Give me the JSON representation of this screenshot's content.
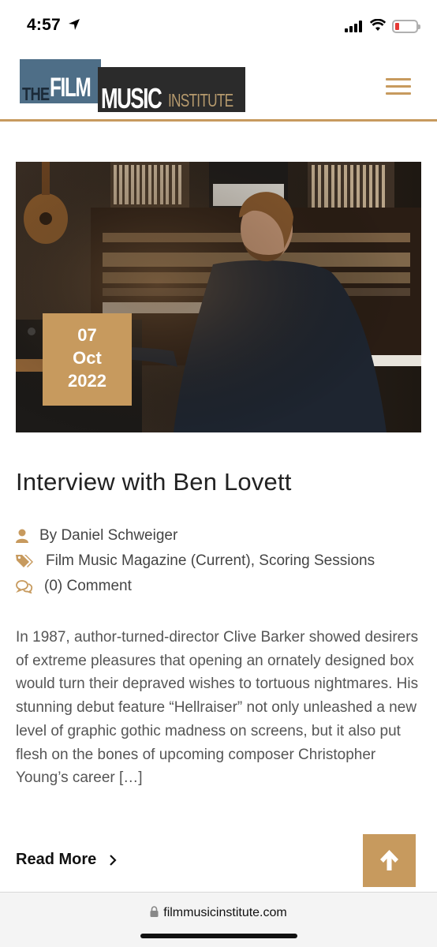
{
  "status_bar": {
    "time": "4:57"
  },
  "header": {
    "logo": {
      "the": "THE",
      "film": "FILM",
      "music": "MUSIC",
      "institute": "INSTITUTE"
    }
  },
  "post": {
    "date": {
      "day": "07",
      "month": "Oct",
      "year": "2022"
    },
    "title": "Interview with Ben Lovett",
    "author": "By Daniel Schweiger",
    "categories": "Film Music Magazine (Current), Scoring Sessions",
    "comments": "(0) Comment",
    "excerpt": "In 1987, author-turned-director Clive Barker showed desirers of extreme pleasures that opening an ornately designed box would turn their depraved wishes to tortuous nightmares. His stunning debut feature “Hellraiser” not only unleashed a new level of graphic gothic madness on screens, but it also put flesh on the bones of upcoming composer Christopher Young’s career […]",
    "read_more": "Read More"
  },
  "browser": {
    "url": "filmmusicinstitute.com"
  },
  "colors": {
    "accent": "#c79a5e",
    "logo_blue": "#4e6e87",
    "logo_dark": "#2b2b2b"
  },
  "icons": [
    "location-arrow-icon",
    "signal-icon",
    "wifi-icon",
    "battery-icon",
    "menu-icon",
    "user-icon",
    "tags-icon",
    "comments-icon",
    "chevron-right-icon",
    "arrow-up-icon",
    "lock-icon"
  ]
}
